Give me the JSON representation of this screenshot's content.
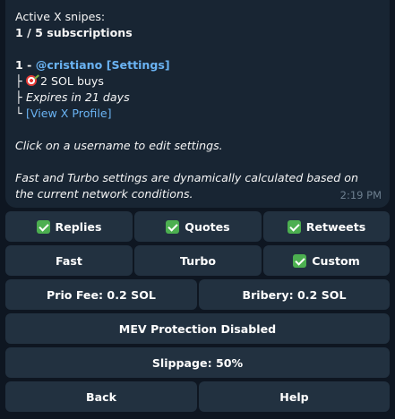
{
  "message": {
    "header": "Active X snipes:",
    "subscriptions": "1 / 5 subscriptions",
    "entry_prefix": "1 - ",
    "entry_username": "@cristiano",
    "entry_settings": "[Settings]",
    "tree_branch": "├",
    "tree_end": "└",
    "buys": "2 SOL buys",
    "expires": "Expires in 21 days",
    "profile_link": "[View X Profile]",
    "hint": "Click on a username to edit settings.",
    "note": "Fast and Turbo settings are dynamically calculated based on the current network conditions.",
    "time": "2:19 PM"
  },
  "buttons": {
    "replies": "Replies",
    "quotes": "Quotes",
    "retweets": "Retweets",
    "fast": "Fast",
    "turbo": "Turbo",
    "custom": "Custom",
    "prio_fee": "Prio Fee: 0.2 SOL",
    "bribery": "Bribery: 0.2 SOL",
    "mev": "MEV Protection Disabled",
    "slippage": "Slippage: 50%",
    "back": "Back",
    "help": "Help"
  },
  "icons": {
    "check": "check-mark-button-icon",
    "target": "direct-hit-icon"
  },
  "colors": {
    "background": "#0e1621",
    "bubble": "#182533",
    "button": "#223140",
    "link": "#6ab3f3",
    "check": "#4caf50",
    "timestamp": "#6d7f8f"
  }
}
